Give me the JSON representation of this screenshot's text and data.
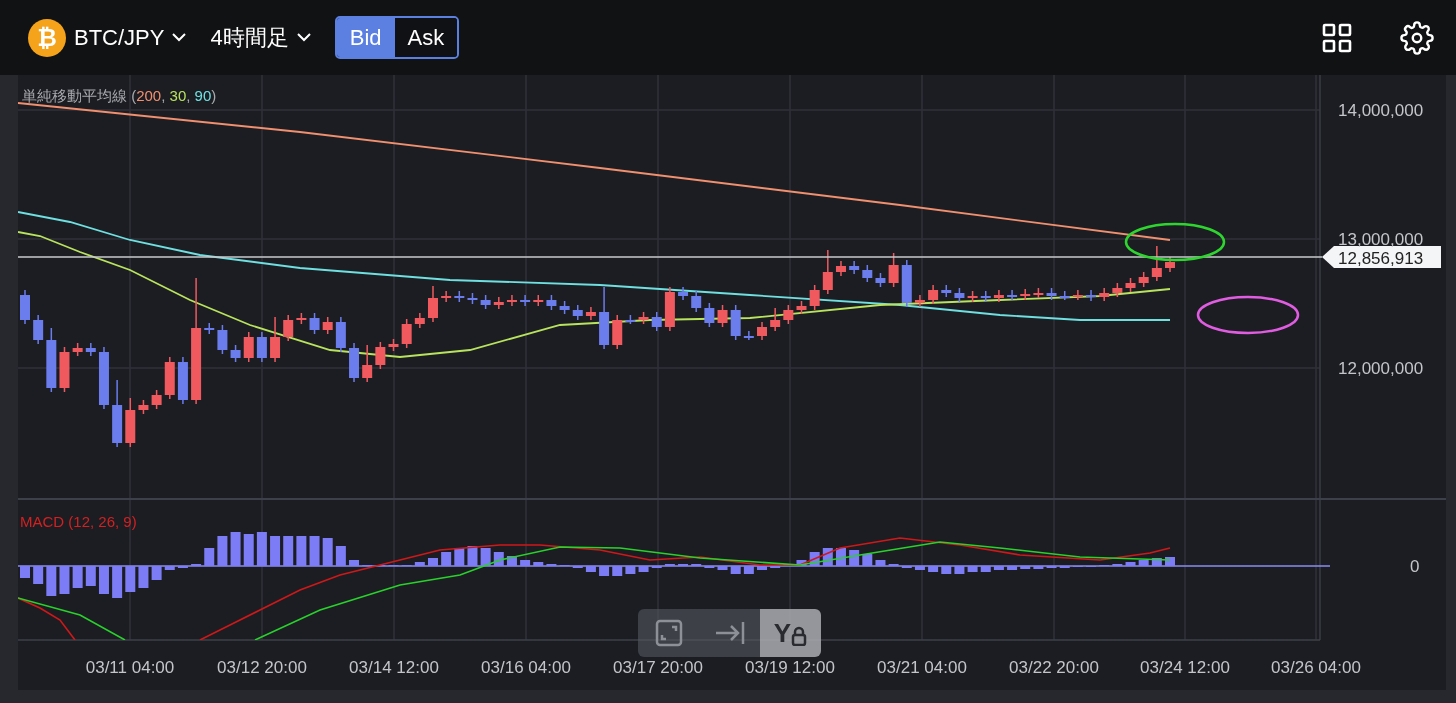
{
  "header": {
    "pair": {
      "symbol": "₿",
      "label": "BTC/JPY"
    },
    "timeframe": {
      "label": "4時間足"
    },
    "price_side": [
      {
        "label": "Bid",
        "selected": true
      },
      {
        "label": "Ask",
        "selected": false
      }
    ]
  },
  "chart": {
    "legend": [
      {
        "text": "単純移動平均線 ("
      },
      {
        "text": "200",
        "color": "#f0906e"
      },
      {
        "text": ", "
      },
      {
        "text": "30",
        "color": "#b8e35c"
      },
      {
        "text": ", "
      },
      {
        "text": "90",
        "color": "#6fe0e0"
      },
      {
        "text": ")"
      }
    ],
    "price_axis": [
      "14,000,000",
      "13,000,000",
      "12,000,000"
    ],
    "last_price": "12,856,913",
    "macd": {
      "label": "MACD (12, 26, 9)",
      "axis": "0"
    },
    "time_axis": [
      "03/11 04:00",
      "03/12 20:00",
      "03/14 12:00",
      "03/16 04:00",
      "03/17 20:00",
      "03/19 12:00",
      "03/21 04:00",
      "03/22 20:00",
      "03/24 12:00",
      "03/26 04:00"
    ],
    "toolbar": [
      {
        "kind": "fit",
        "selected": false
      },
      {
        "kind": "scroll-end",
        "selected": false
      },
      {
        "kind": "y-lock",
        "label": "Y",
        "selected": true
      }
    ]
  }
}
